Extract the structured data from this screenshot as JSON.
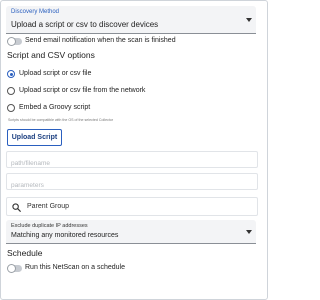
{
  "discovery_method": {
    "label": "Discovery Method",
    "value": "Upload a script or csv to discover devices"
  },
  "email_toggle": {
    "label": "Send email notification when the scan is finished",
    "checked": false
  },
  "script_section": {
    "title": "Script and CSV options",
    "options": [
      {
        "label": "Upload script or csv file",
        "selected": true
      },
      {
        "label": "Upload script or csv file from the network",
        "selected": false
      },
      {
        "label": "Embed a Groovy script",
        "selected": false
      }
    ],
    "hint": "Scripts should be compatible with the OS of the selected Collector",
    "upload_button": "Upload Script",
    "path_placeholder": "path/filename",
    "parameters_placeholder": "parameters"
  },
  "parent_group": {
    "label": "Parent Group",
    "icon": "search-icon"
  },
  "exclude_duplicates": {
    "label": "Exclude duplicate IP addresses",
    "value": "Matching any monitored resources"
  },
  "schedule": {
    "title": "Schedule",
    "toggle_label": "Run this NetScan on a schedule",
    "checked": false
  },
  "colors": {
    "accent": "#2a5fbf",
    "field_bg": "#f3f4f6",
    "border": "#e1e4e8"
  }
}
